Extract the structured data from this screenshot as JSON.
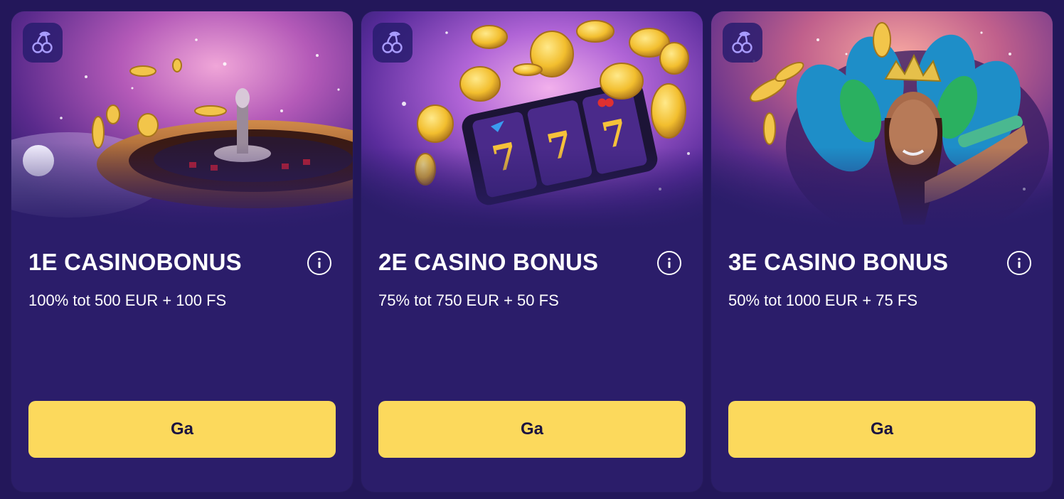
{
  "colors": {
    "page_background": "#23175a",
    "card_background": "#2b1d6a",
    "button_yellow": "#fcd95c",
    "button_text": "#1b1340",
    "text_white": "#ffffff",
    "badge_icon": "#a99cff"
  },
  "cards": [
    {
      "badge_icon": "cherries-icon",
      "image": "roulette-wheel-image",
      "title": "1E CASINOBONUS",
      "info_icon": "info-icon",
      "description": "100% tot 500 EUR + 100 FS",
      "button_label": "Ga"
    },
    {
      "badge_icon": "cherries-icon",
      "image": "slot-machine-coins-image",
      "title": "2E CASINO BONUS",
      "info_icon": "info-icon",
      "description": "75% tot 750 EUR + 50 FS",
      "button_label": "Ga"
    },
    {
      "badge_icon": "cherries-icon",
      "image": "carnival-dancer-image",
      "title": "3E CASINO BONUS",
      "info_icon": "info-icon",
      "description": "50% tot 1000 EUR + 75 FS",
      "button_label": "Ga"
    }
  ]
}
